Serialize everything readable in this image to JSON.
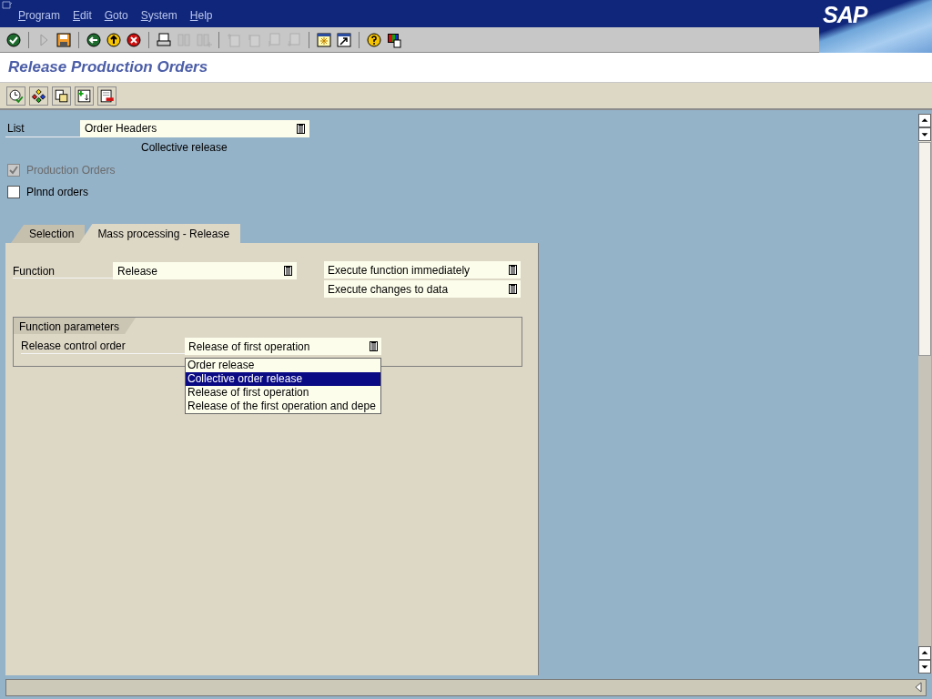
{
  "menu": [
    "Program",
    "Edit",
    "Goto",
    "System",
    "Help"
  ],
  "logo": "SAP",
  "toolbar": [
    {
      "disabled": false
    },
    {
      "disabled": true
    },
    {
      "disabled": false
    },
    {
      "disabled": false
    },
    {
      "disabled": false
    },
    {
      "disabled": false
    },
    {
      "disabled": false
    },
    {
      "disabled": true
    },
    {
      "disabled": true
    },
    {
      "disabled": true
    },
    {
      "disabled": true
    },
    {
      "disabled": true
    },
    {
      "disabled": true
    },
    {
      "disabled": false
    },
    {
      "disabled": false
    },
    {
      "disabled": false
    },
    {
      "disabled": false
    }
  ],
  "title": "Release Production Orders",
  "list": {
    "label": "List",
    "value": "Order Headers",
    "caption": "Collective release"
  },
  "checkboxes": [
    {
      "label": "Production Orders",
      "checked": true,
      "disabled": true
    },
    {
      "label": "Plnnd orders",
      "checked": false,
      "disabled": false
    }
  ],
  "tabs": [
    {
      "label": "Selection",
      "selected": false
    },
    {
      "label": "Mass processing - Release",
      "selected": true
    }
  ],
  "function": {
    "label": "Function",
    "value": "Release"
  },
  "options": [
    "Execute function immediately",
    "Execute changes to data"
  ],
  "group": {
    "title": "Function parameters",
    "label": "Release control order",
    "value": "Release of first operation"
  },
  "dropdown": [
    {
      "label": "Order release",
      "selected": false
    },
    {
      "label": "Collective order release",
      "selected": true
    },
    {
      "label": "Release of first operation",
      "selected": false
    },
    {
      "label": "Release of the first operation and depe",
      "selected": false
    }
  ]
}
